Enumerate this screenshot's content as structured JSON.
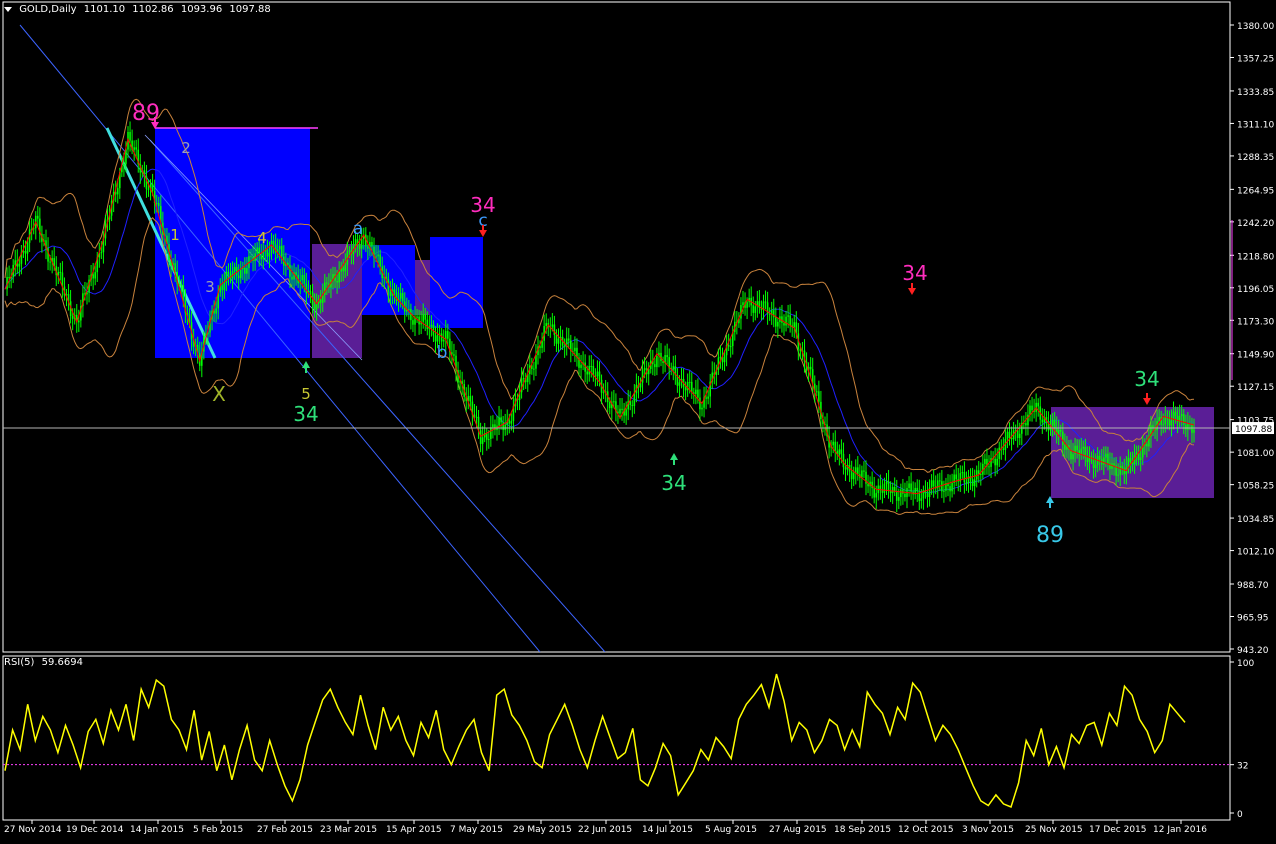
{
  "header": {
    "symbol": "GOLD,Daily",
    "open": "1101.10",
    "high": "1102.86",
    "low": "1093.96",
    "close": "1097.88"
  },
  "rsi_header": {
    "label": "RSI(5)",
    "value": "59.6694"
  },
  "colors": {
    "background": "#000000",
    "candle": "#00ff00",
    "bollinger": "#c8823c",
    "ma": "#2020ff",
    "zigzag": "#ff0000",
    "rsi": "#ffff00",
    "blue_box": "#0000ff",
    "purple_box": "#5a1e96"
  },
  "chart_data": [
    {
      "type": "candlestick",
      "title": "GOLD,Daily",
      "x_ticks": [
        "27 Nov 2014",
        "19 Dec 2014",
        "14 Jan 2015",
        "5 Feb 2015",
        "27 Feb 2015",
        "23 Mar 2015",
        "15 Apr 2015",
        "7 May 2015",
        "29 May 2015",
        "22 Jun 2015",
        "14 Jul 2015",
        "5 Aug 2015",
        "27 Aug 2015",
        "18 Sep 2015",
        "12 Oct 2015",
        "3 Nov 2015",
        "25 Nov 2015",
        "17 Dec 2015",
        "12 Jan 2016"
      ],
      "y_ticks": [
        "1380.00",
        "1357.25",
        "1333.85",
        "1311.10",
        "1288.35",
        "1264.95",
        "1242.20",
        "1218.80",
        "1196.05",
        "1173.30",
        "1149.90",
        "1127.15",
        "1103.75",
        "1081.00",
        "1058.25",
        "1034.85",
        "1012.10",
        "988.70",
        "965.95",
        "943.20"
      ],
      "ylim": [
        943.2,
        1380.0
      ],
      "current_price": "1097.88",
      "price_path": {
        "x_index": [
          0,
          15,
          35,
          48,
          60,
          72,
          95,
          105,
          130,
          152,
          175,
          190,
          200,
          215,
          232,
          245,
          265,
          290,
          300,
          318,
          340,
          362,
          385,
          392,
          403,
          410,
          425,
          445,
          462,
          475,
          503,
          520,
          547,
          565,
          580
        ],
        "close": [
          1195,
          1242,
          1172,
          1230,
          1300,
          1262,
          1145,
          1198,
          1226,
          1185,
          1233,
          1190,
          1175,
          1160,
          1092,
          1102,
          1170,
          1130,
          1105,
          1150,
          1115,
          1188,
          1168,
          1138,
          1085,
          1072,
          1055,
          1052,
          1060,
          1065,
          1112,
          1082,
          1068,
          1106,
          1100
        ]
      },
      "annotations": [
        {
          "text": "89",
          "color": "#ff2dbe"
        },
        {
          "text": "2",
          "color": "#9aa0b4"
        },
        {
          "text": "1",
          "color": "#c8c832"
        },
        {
          "text": "4",
          "color": "#c8c832"
        },
        {
          "text": "3",
          "color": "#9aa0b4"
        },
        {
          "text": "X",
          "color": "#a0b428"
        },
        {
          "text": "5",
          "color": "#c8c832"
        },
        {
          "text": "34",
          "color": "#2ee07a"
        },
        {
          "text": "a",
          "color": "#3c9bff"
        },
        {
          "text": "b",
          "color": "#3c9bff"
        },
        {
          "text": "c",
          "color": "#3c9bff"
        },
        {
          "text": "34",
          "color": "#ff2dbe"
        },
        {
          "text": "34",
          "color": "#2ee07a"
        },
        {
          "text": "34",
          "color": "#ff2dbe"
        },
        {
          "text": "34",
          "color": "#2ee07a"
        },
        {
          "text": "89",
          "color": "#38c8e8"
        }
      ]
    },
    {
      "type": "line",
      "title": "RSI(5) 59.6694",
      "y_ticks": [
        "100",
        "32",
        "0"
      ],
      "ylim": [
        0,
        100
      ],
      "level": 32,
      "series": [
        {
          "name": "RSI(5)",
          "values": [
            28,
            55,
            42,
            72,
            48,
            64,
            55,
            40,
            58,
            45,
            30,
            54,
            62,
            46,
            68,
            55,
            72,
            48,
            82,
            70,
            88,
            84,
            62,
            55,
            42,
            68,
            35,
            54,
            28,
            45,
            22,
            42,
            58,
            35,
            28,
            48,
            32,
            18,
            8,
            22,
            45,
            60,
            75,
            82,
            70,
            60,
            52,
            78,
            58,
            42,
            70,
            55,
            64,
            48,
            38,
            60,
            50,
            68,
            42,
            32,
            44,
            55,
            62,
            40,
            28,
            78,
            82,
            65,
            58,
            48,
            34,
            30,
            52,
            62,
            72,
            58,
            42,
            30,
            48,
            64,
            50,
            36,
            40,
            56,
            22,
            18,
            30,
            46,
            38,
            12,
            20,
            28,
            42,
            35,
            50,
            44,
            36,
            62,
            72,
            78,
            85,
            70,
            92,
            74,
            48,
            60,
            55,
            40,
            48,
            62,
            58,
            42,
            55,
            44,
            80,
            72,
            66,
            52,
            70,
            62,
            86,
            80,
            64,
            48,
            58,
            52,
            42,
            30,
            18,
            8,
            5,
            12,
            6,
            4,
            20,
            48,
            38,
            56,
            32,
            44,
            30,
            52,
            46,
            58,
            60,
            45,
            66,
            58,
            84,
            78,
            62,
            54,
            40,
            48,
            72,
            66,
            60
          ]
        }
      ]
    }
  ]
}
